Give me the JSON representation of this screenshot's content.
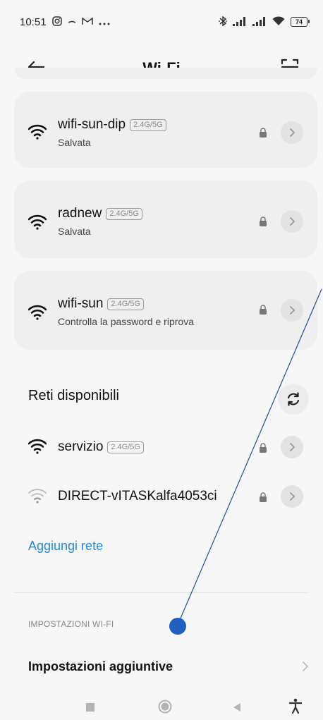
{
  "status_bar": {
    "time": "10:51",
    "battery": "74"
  },
  "header": {
    "title": "Wi-Fi"
  },
  "saved_networks": [
    {
      "name": "wifi-sun-dip",
      "band": "2.4G/5G",
      "status": "Salvata"
    },
    {
      "name": "radnew",
      "band": "2.4G/5G",
      "status": "Salvata"
    },
    {
      "name": "wifi-sun",
      "band": "2.4G/5G",
      "status": "Controlla la password e riprova"
    }
  ],
  "available": {
    "title": "Reti disponibili",
    "networks": [
      {
        "name": "servizio",
        "band": "2.4G/5G"
      },
      {
        "name": "DIRECT-vITASKalfa4053ci"
      }
    ]
  },
  "add_network_label": "Aggiungi rete",
  "settings": {
    "header": "IMPOSTAZIONI WI-FI",
    "additional_label": "Impostazioni aggiuntive"
  },
  "colors": {
    "accent": "#1e88e5",
    "card_bg": "#efefef",
    "page_bg": "#f7f7f7",
    "touch_marker": "#1f5fbf"
  },
  "icons": {
    "back": "arrow-left-icon",
    "scan": "qr-scan-icon",
    "wifi": "wifi-icon",
    "lock": "lock-icon",
    "chevron": "chevron-right-icon",
    "refresh": "refresh-icon"
  }
}
